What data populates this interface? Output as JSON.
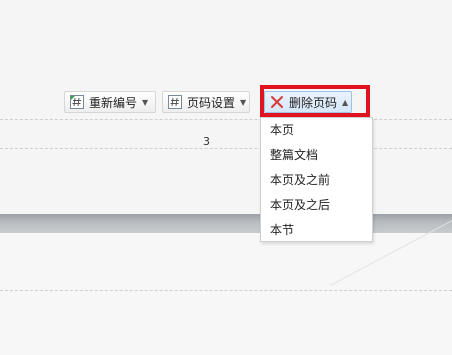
{
  "toolbar": {
    "renumber_label": "重新编号",
    "pagesetup_label": "页码设置",
    "delete_label": "删除页码"
  },
  "page": {
    "number": "3"
  },
  "dropdown": {
    "items": [
      {
        "label": "本页"
      },
      {
        "label": "整篇文档"
      },
      {
        "label": "本页及之前"
      },
      {
        "label": "本页及之后"
      },
      {
        "label": "本节"
      }
    ]
  },
  "icons": {
    "renumber": "hash-refresh-icon",
    "pagesetup": "hash-icon",
    "delete": "red-x-icon",
    "caret": "caret-down-icon"
  },
  "colors": {
    "highlight": "#e0141e",
    "delete_x": "#d63a3a",
    "active_button_bg": "#d6e7f8"
  }
}
